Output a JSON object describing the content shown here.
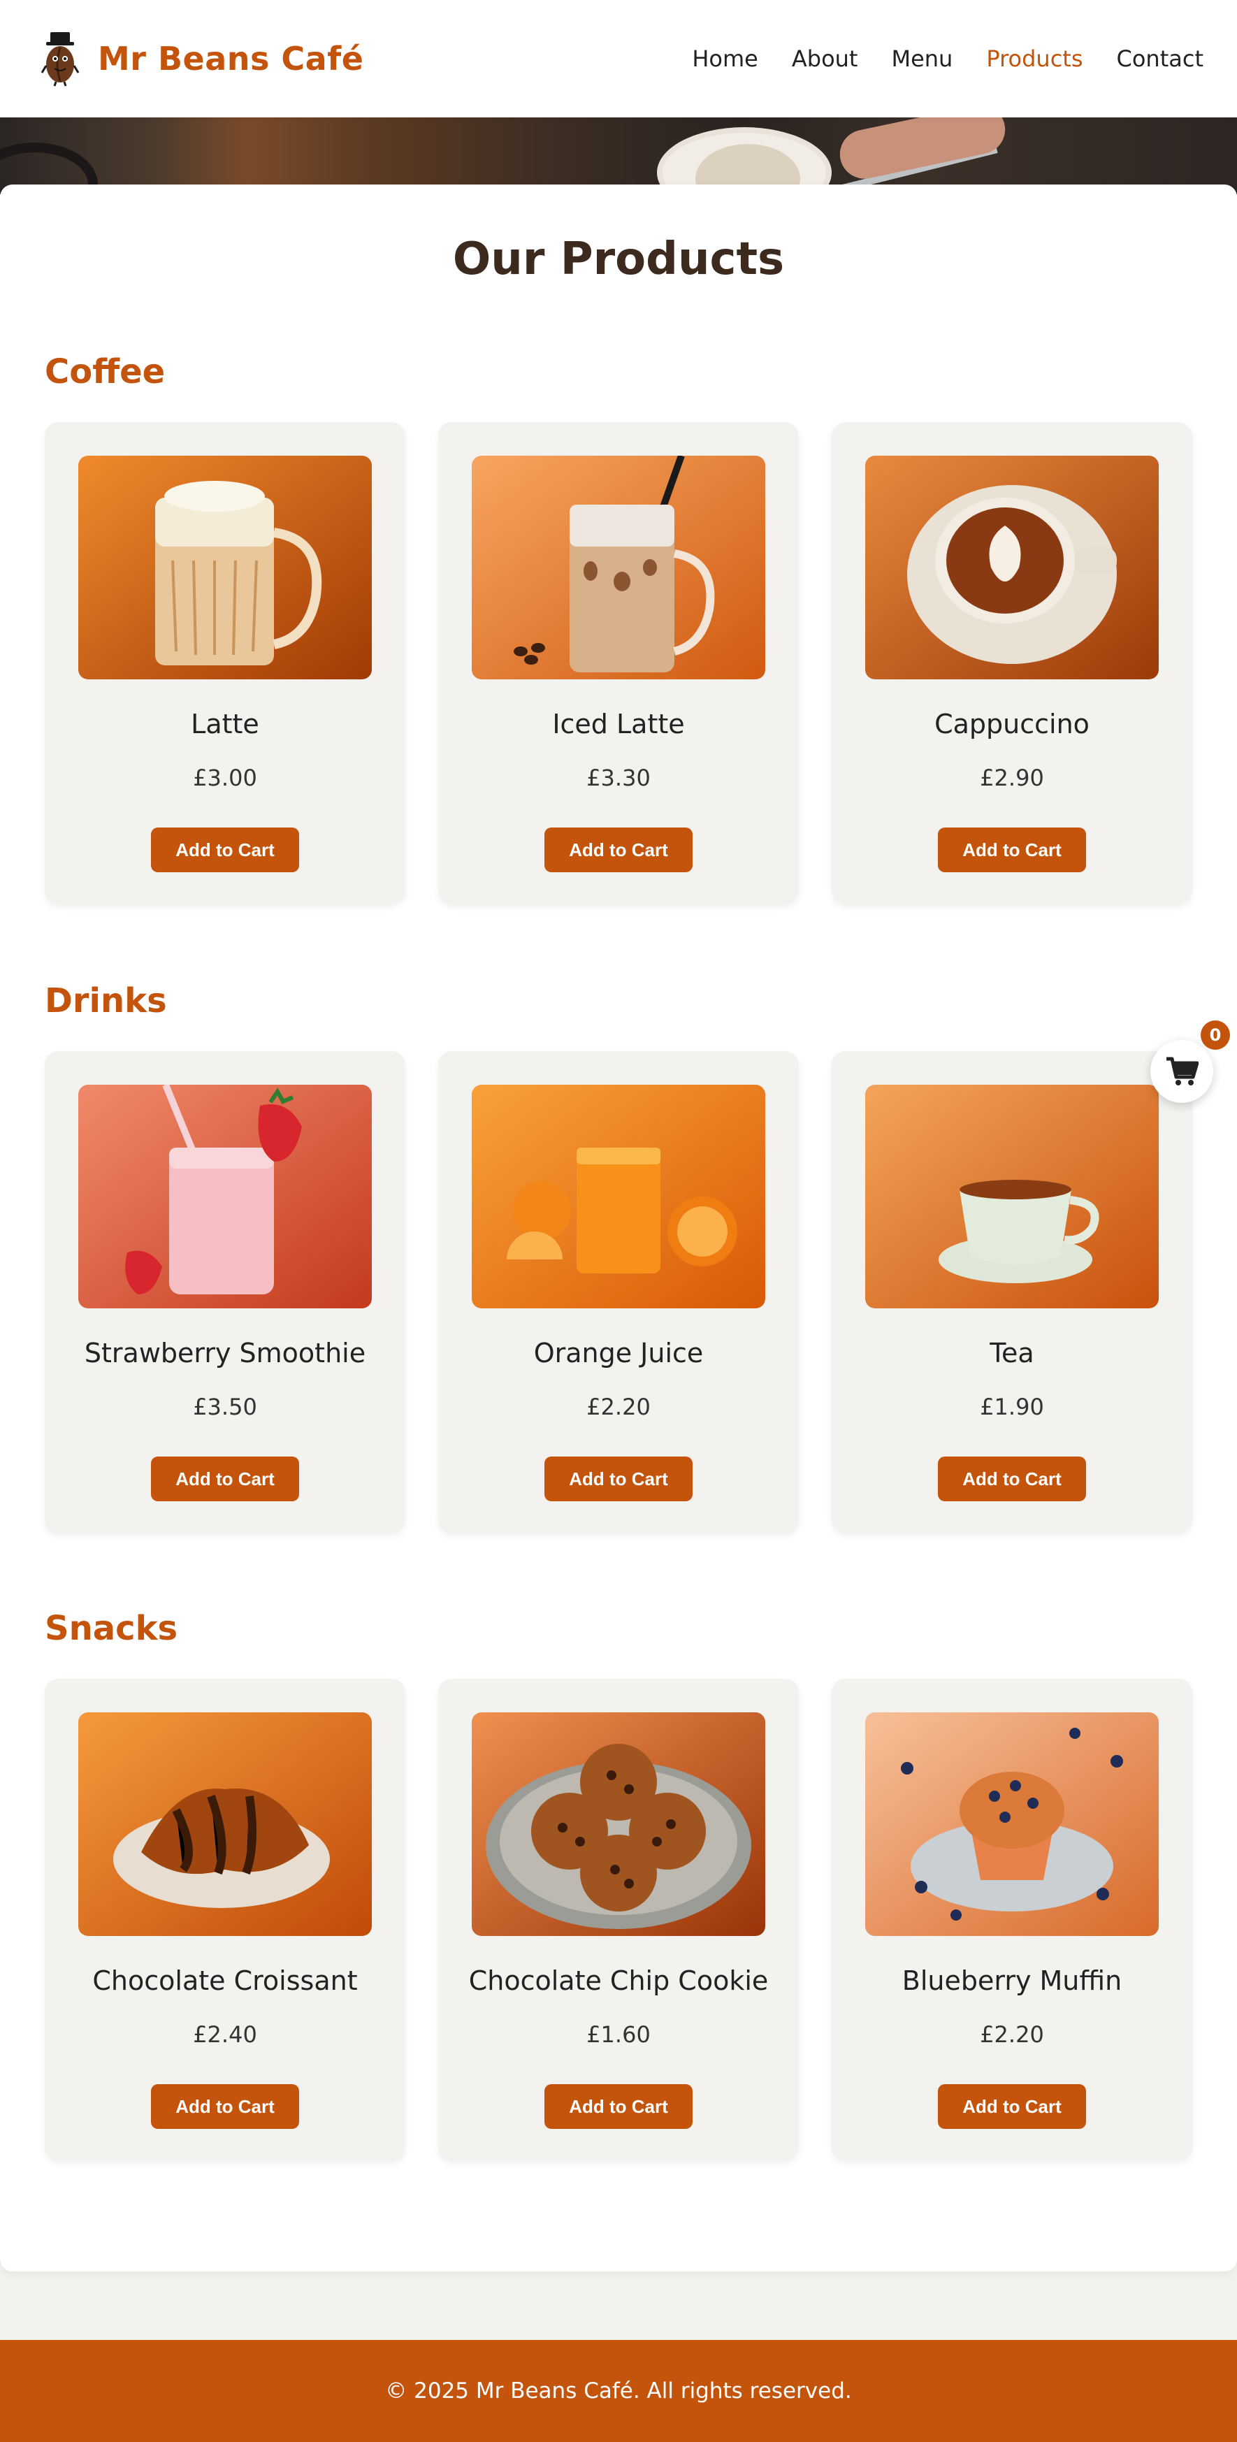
{
  "brand": {
    "name": "Mr Beans Café"
  },
  "nav": [
    {
      "label": "Home",
      "active": false
    },
    {
      "label": "About",
      "active": false
    },
    {
      "label": "Menu",
      "active": false
    },
    {
      "label": "Products",
      "active": true
    },
    {
      "label": "Contact",
      "active": false
    }
  ],
  "page": {
    "title": "Our Products"
  },
  "sections": [
    {
      "title": "Coffee",
      "products": [
        {
          "name": "Latte",
          "price": "£3.00",
          "button": "Add to Cart"
        },
        {
          "name": "Iced Latte",
          "price": "£3.30",
          "button": "Add to Cart"
        },
        {
          "name": "Cappuccino",
          "price": "£2.90",
          "button": "Add to Cart"
        }
      ]
    },
    {
      "title": "Drinks",
      "products": [
        {
          "name": "Strawberry Smoothie",
          "price": "£3.50",
          "button": "Add to Cart"
        },
        {
          "name": "Orange Juice",
          "price": "£2.20",
          "button": "Add to Cart"
        },
        {
          "name": "Tea",
          "price": "£1.90",
          "button": "Add to Cart"
        }
      ]
    },
    {
      "title": "Snacks",
      "products": [
        {
          "name": "Chocolate Croissant",
          "price": "£2.40",
          "button": "Add to Cart"
        },
        {
          "name": "Chocolate Chip Cookie",
          "price": "£1.60",
          "button": "Add to Cart"
        },
        {
          "name": "Blueberry Muffin",
          "price": "£2.20",
          "button": "Add to Cart"
        }
      ]
    }
  ],
  "cart": {
    "count": "0",
    "icon": "cart-icon"
  },
  "footer": {
    "text": "© 2025 Mr Beans Café. All rights reserved."
  },
  "colors": {
    "accent": "#c4540b",
    "card_bg": "#f4f2ee",
    "title": "#3c2a1e"
  }
}
